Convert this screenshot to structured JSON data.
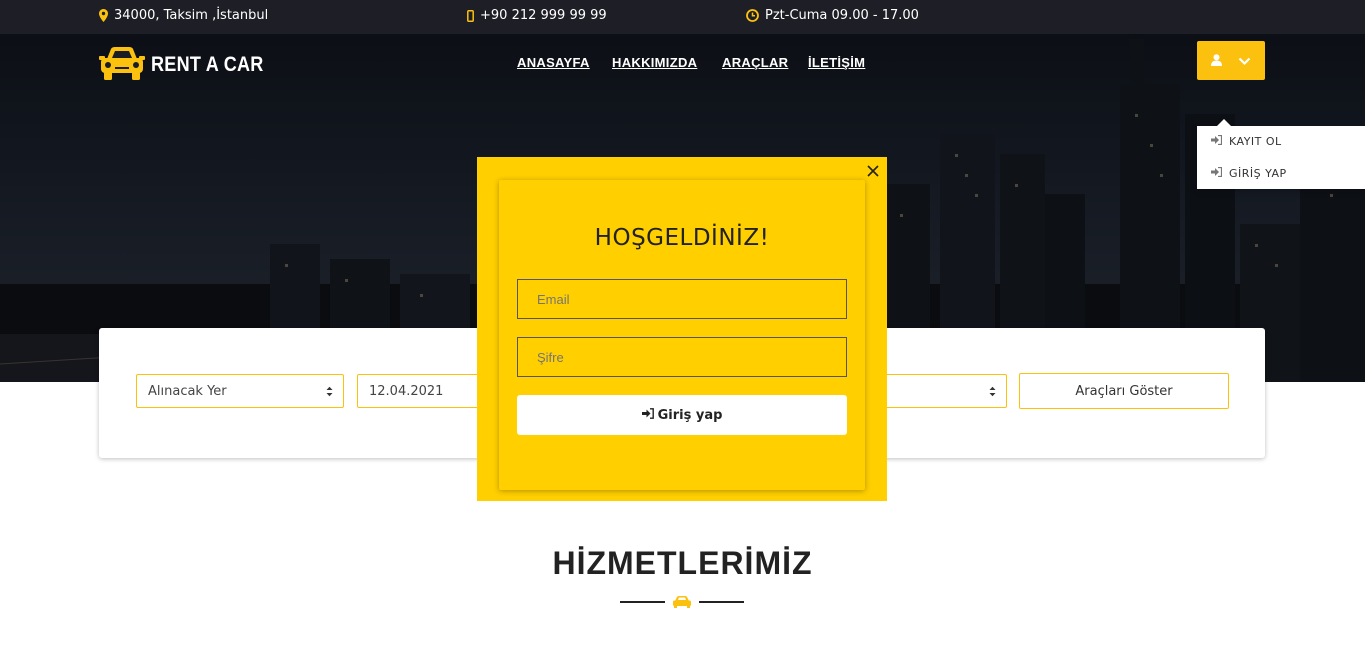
{
  "topbar": {
    "address": "34000, Taksim ,İstanbul",
    "phone": "+90 212 999 99 99",
    "hours": "Pzt-Cuma 09.00 - 17.00"
  },
  "brand": {
    "name": "RENT A CAR",
    "accent": "#fcc10e"
  },
  "nav": {
    "home": "ANASAYFA",
    "about": "HAKKIMIZDA",
    "cars": "ARAÇLAR",
    "contact": "İLETİŞİM"
  },
  "user_menu": {
    "register": "KAYIT OL",
    "login": "GİRİŞ YAP"
  },
  "search": {
    "pickup_place": "Alınacak Yer",
    "pickup_date": "12.04.2021",
    "show_button": "Araçları Göster"
  },
  "modal": {
    "title": "HOŞGELDİNİZ!",
    "email_placeholder": "Email",
    "password_placeholder": "Şifre",
    "submit": "Giriş yap",
    "bg_color": "#ffcf00"
  },
  "services": {
    "title": "HİZMETLERİMİZ"
  }
}
